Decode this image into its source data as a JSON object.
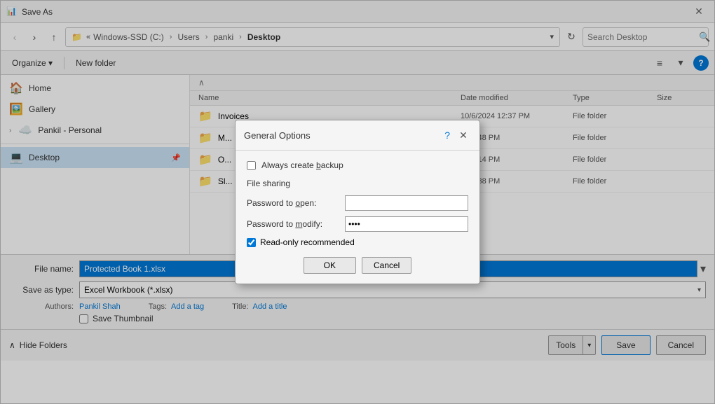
{
  "titleBar": {
    "icon": "📊",
    "title": "Save As",
    "closeLabel": "✕"
  },
  "addressBar": {
    "backLabel": "‹",
    "forwardLabel": "›",
    "upLabel": "↑",
    "recentLabel": "▾",
    "refreshLabel": "↻",
    "pathParts": [
      "Windows-SSD (C:)",
      "Users",
      "panki",
      "Desktop"
    ],
    "searchPlaceholder": "Search Desktop"
  },
  "toolbar": {
    "organizeLabel": "Organize ▾",
    "newFolderLabel": "New folder",
    "viewLabel": "≡",
    "viewArrow": "▾",
    "helpLabel": "?"
  },
  "fileListHeader": {
    "name": "Name",
    "dateModified": "Date modified",
    "type": "Type",
    "size": "Size"
  },
  "files": [
    {
      "icon": "📁",
      "name": "Invoices",
      "date": "10/6/2024 12:37 PM",
      "type": "File folder",
      "size": ""
    },
    {
      "icon": "📁",
      "name": "M...",
      "date": "24 2:48 PM",
      "type": "File folder",
      "size": ""
    },
    {
      "icon": "📁",
      "name": "O...",
      "date": "24 2:14 PM",
      "type": "File folder",
      "size": ""
    },
    {
      "icon": "📁",
      "name": "Sl...",
      "date": "24 3:38 PM",
      "type": "File folder",
      "size": ""
    }
  ],
  "sidebar": {
    "items": [
      {
        "icon": "🏠",
        "label": "Home",
        "indent": 0
      },
      {
        "icon": "🖼️",
        "label": "Gallery",
        "indent": 0
      },
      {
        "icon": "☁️",
        "label": "Pankil - Personal",
        "indent": 0,
        "expand": "›"
      },
      {
        "icon": "💻",
        "label": "Desktop",
        "indent": 0,
        "active": true
      }
    ]
  },
  "bottomSection": {
    "fileNameLabel": "File name:",
    "fileNameValue": "Protected Book 1.xlsx",
    "fileTypeLabel": "Save as type:",
    "fileTypeValue": "Excel Workbook (*.xlsx)",
    "authorsLabel": "Authors:",
    "authorsValue": "Pankil Shah",
    "tagsLabel": "Tags:",
    "tagsValue": "Add a tag",
    "titleLabel": "Title:",
    "titleValue": "Add a title",
    "thumbnailLabel": "Save Thumbnail",
    "thumbnailChecked": false
  },
  "actionBar": {
    "hideFoldersIcon": "∧",
    "hideFoldersLabel": "Hide Folders",
    "toolsLabel": "Tools",
    "toolsArrow": "▾",
    "saveLabel": "Save",
    "cancelLabel": "Cancel"
  },
  "dialog": {
    "title": "General Options",
    "helpLabel": "?",
    "closeLabel": "✕",
    "alwaysBackupLabel": "Always create backup",
    "fileSharingLabel": "File sharing",
    "passwordOpenLabel": "Password to open:",
    "passwordOpenValue": "",
    "passwordModifyLabel": "Password to modify:",
    "passwordModifyValue": "••••",
    "readOnlyLabel": "Read-only recommended",
    "readOnlyChecked": true,
    "okLabel": "OK",
    "cancelLabel": "Cancel"
  }
}
